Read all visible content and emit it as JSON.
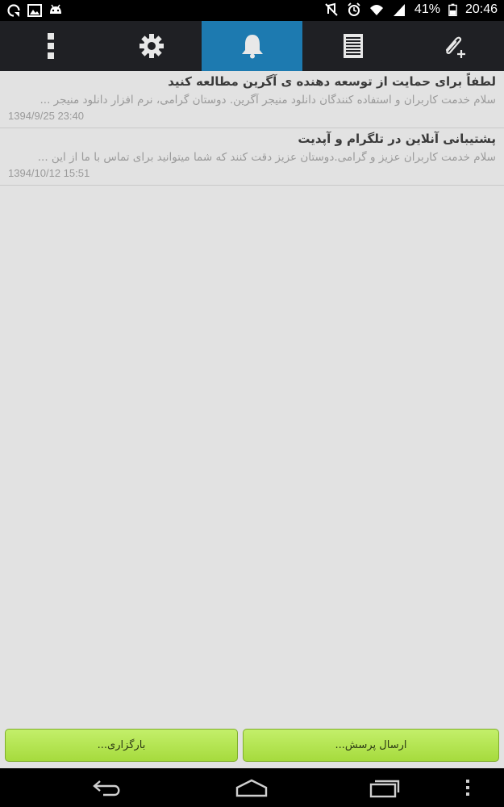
{
  "status_bar": {
    "battery_percent": "41%",
    "time": "20:46"
  },
  "toolbar": {
    "tabs": [
      {
        "icon": "overflow-menu-icon",
        "active": false
      },
      {
        "icon": "gear-icon",
        "active": false
      },
      {
        "icon": "bell-icon",
        "active": true
      },
      {
        "icon": "document-list-icon",
        "active": false
      },
      {
        "icon": "attach-add-icon",
        "active": false
      }
    ],
    "active_color": "#1d7ab0"
  },
  "messages": [
    {
      "title": "لطفاً برای حمایت از توسعه دهنده ی آگرین مطالعه کنید",
      "preview": "سلام خدمت کاربران و استفاده کنندگان دانلود منیجر آگرین. دوستان گرامی، نرم افزار دانلود منیجر ...",
      "date": "1394/9/25 23:40"
    },
    {
      "title": "پشتیبانی آنلاین در تلگرام و آپدیت",
      "preview": "سلام خدمت کاربران عزیز و گرامی.دوستان عزیز دقت کنند که شما میتوانید برای تماس با ما از این ...",
      "date": "1394/10/12 15:51"
    }
  ],
  "buttons": {
    "reload_label": "بارگزاری...",
    "send_label": "ارسال پرسش..."
  },
  "navbar": {
    "items": [
      "back-icon",
      "home-icon",
      "recents-icon",
      "menu-icon"
    ]
  }
}
